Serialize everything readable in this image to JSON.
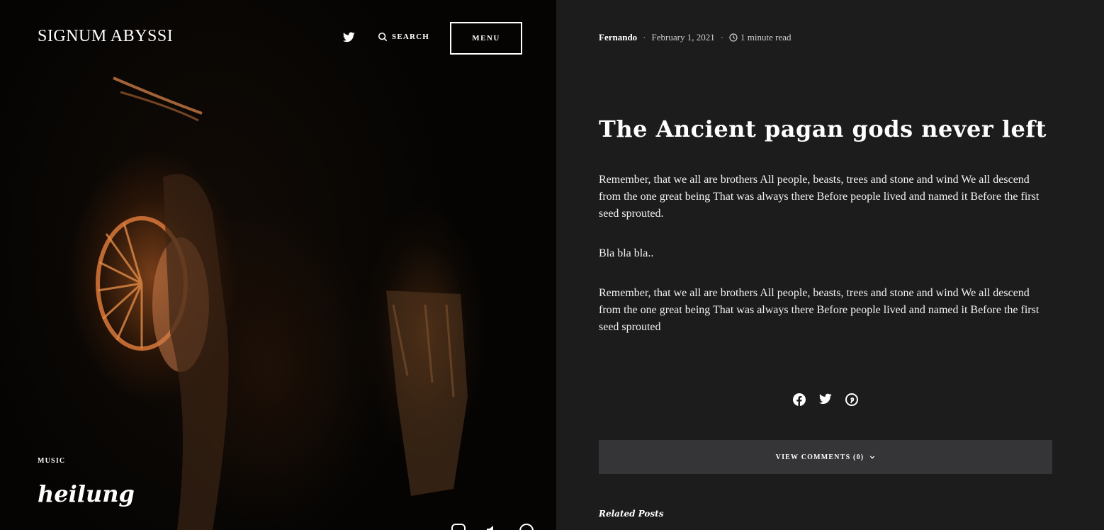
{
  "site": {
    "title": "SIGNUM ABYSSI"
  },
  "nav": {
    "search_label": "SEARCH",
    "menu_label": "MENU"
  },
  "hero": {
    "category": "MUSIC",
    "title": "heilung"
  },
  "article": {
    "author": "Fernando",
    "date": "February 1, 2021",
    "read_time": "1 minute read",
    "title": "The Ancient pagan gods never left",
    "paragraphs": [
      "Remember, that we all are brothers All people, beasts, trees and stone and wind We all descend from the one great being That was always there Before people lived and named it Before the first seed sprouted.",
      "Bla bla bla..",
      "Remember, that we all are brothers All people, beasts, trees and stone and wind We all descend from the one great being That was always there Before people lived and named it Before the first seed sprouted"
    ],
    "share_icons": [
      "facebook-icon",
      "twitter-icon",
      "pinterest-icon"
    ],
    "comments_button": "VIEW COMMENTS (0)",
    "related_heading": "Related Posts"
  },
  "colors": {
    "background": "#1c1c1c",
    "button": "#353537",
    "text": "#ffffff",
    "hero_glow": "#cd6928"
  }
}
